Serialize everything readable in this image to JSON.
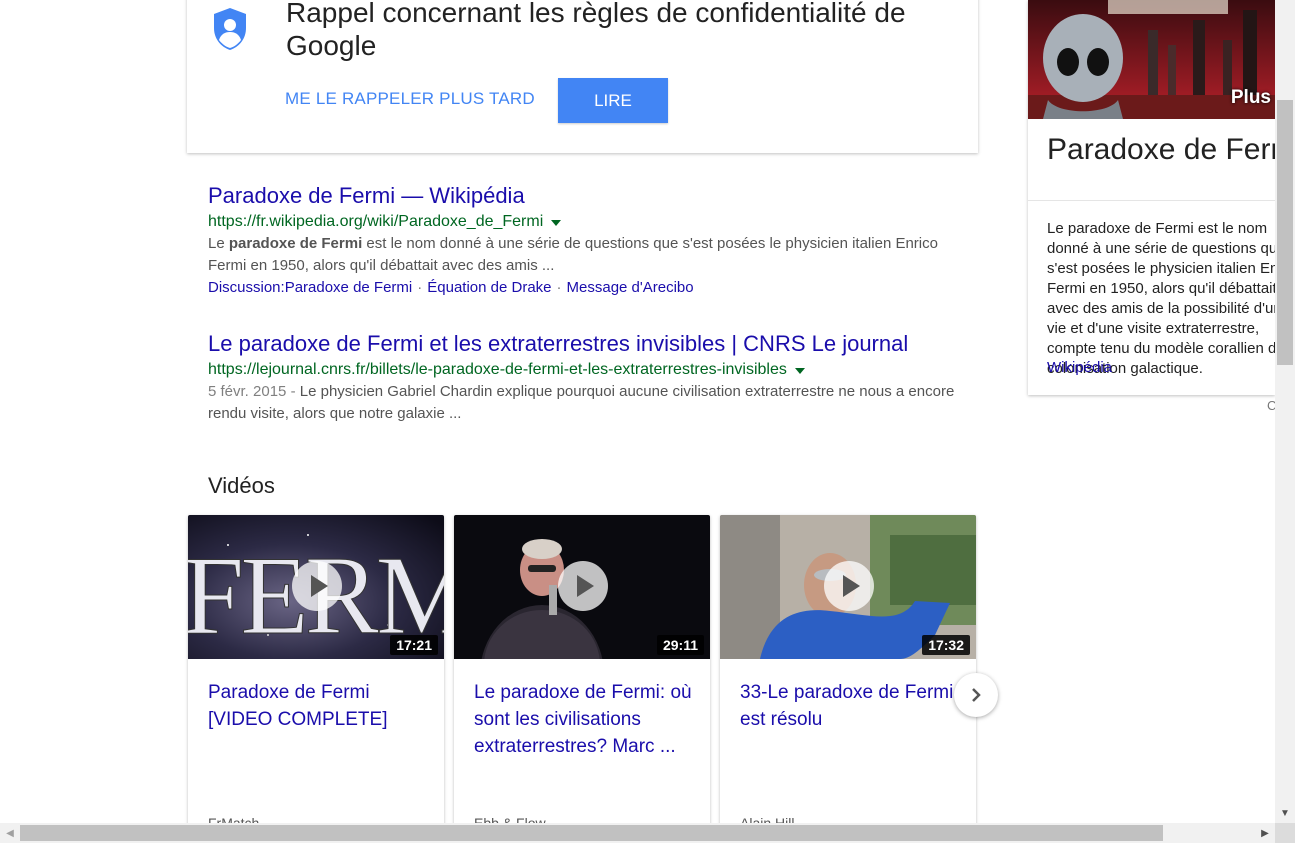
{
  "privacy_card": {
    "title": "Rappel concernant les règles de confidentialité de Google",
    "remind_later_label": "ME LE RAPPELER PLUS TARD",
    "read_label": "LIRE",
    "icon": "shield-user-icon",
    "accent_color": "#4285f4"
  },
  "results": [
    {
      "title": "Paradoxe de Fermi — Wikipédia",
      "url": "https://fr.wikipedia.org/wiki/Paradoxe_de_Fermi",
      "snippet_pre": "Le ",
      "snippet_bold": "paradoxe de Fermi",
      "snippet_post": " est le nom donné à une série de questions que s'est posées le physicien italien Enrico Fermi en 1950, alors qu'il débattait avec des amis ...",
      "sitelinks": [
        "Discussion:Paradoxe de Fermi",
        "Équation de Drake",
        "Message d'Arecibo"
      ]
    },
    {
      "title": "Le paradoxe de Fermi et les extraterrestres invisibles | CNRS Le journal",
      "url": "https://lejournal.cnrs.fr/billets/le-paradoxe-de-fermi-et-les-extraterrestres-invisibles",
      "date": "5 févr. 2015",
      "date_sep": " - ",
      "snippet": "Le physicien Gabriel Chardin explique pourquoi aucune civilisation extraterrestre ne nous a encore rendu visite, alors que notre galaxie ..."
    }
  ],
  "videos": {
    "heading": "Vidéos",
    "items": [
      {
        "title": "Paradoxe de Fermi [VIDEO COMPLETE]",
        "duration": "17:21",
        "channel": "FrMatch..."
      },
      {
        "title": "Le paradoxe de Fermi: où sont les civilisations extraterrestres? Marc ...",
        "duration": "29:11",
        "channel": "Ebb & Flow"
      },
      {
        "title": "33-Le paradoxe de Fermi est résolu",
        "duration": "17:32",
        "channel": "Alain Hill..."
      }
    ],
    "next_icon": "chevron-right-icon"
  },
  "knowledge_panel": {
    "more_label": "Plus",
    "title": "Paradoxe de Fermi",
    "description": "Le paradoxe de Fermi est le nom donné à une série de questions que s'est posées le physicien italien Enrico Fermi en 1950, alors qu'il débattait avec des amis de la possibilité d'une vie et d'une visite extraterrestre, compte tenu du modèle corallien de colonisation galactique.",
    "source": "Wikipédia",
    "edge_char": "C"
  },
  "colors": {
    "link": "#1a0dab",
    "url": "#006621",
    "snippet": "#545454",
    "button": "#4285f4"
  }
}
